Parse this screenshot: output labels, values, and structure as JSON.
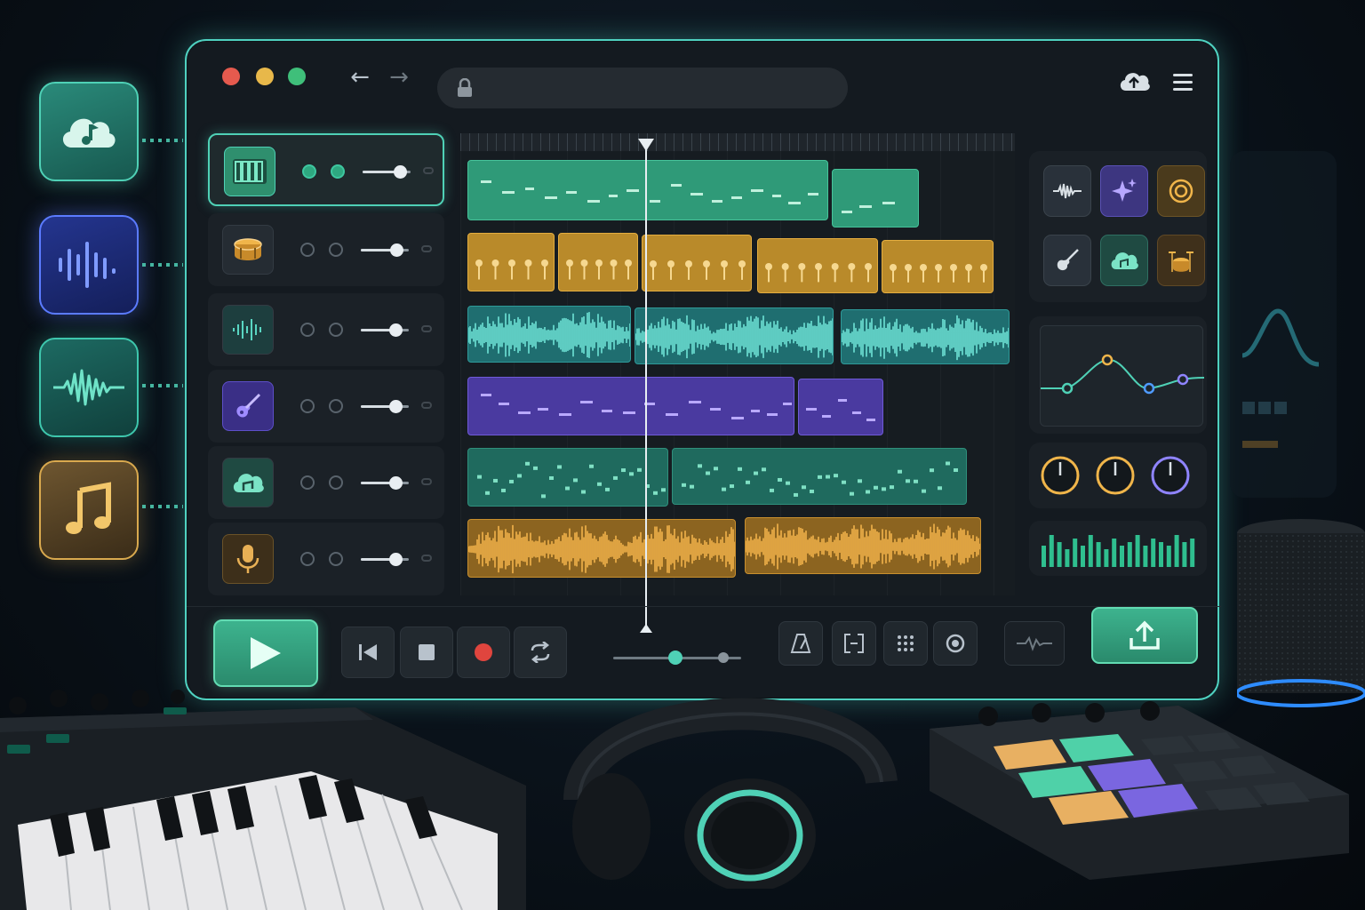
{
  "colors": {
    "accent": "#4fd1b6",
    "green": "#2f9a78",
    "yellow": "#b98a2a",
    "teal": "#1f6e70",
    "purple": "#4a3aa0",
    "amber": "#8c6420"
  },
  "window": {
    "traffic_lights": [
      "close",
      "minimize",
      "maximize"
    ],
    "nav_back_icon": "←",
    "nav_forward_icon": "→",
    "url": ""
  },
  "sources": [
    {
      "icon": "cloud-music-icon"
    },
    {
      "icon": "audio-bars-icon"
    },
    {
      "icon": "waveform-icon"
    },
    {
      "icon": "music-note-icon"
    }
  ],
  "tracks": [
    {
      "icon": "piano-keys-icon",
      "volume": 0.78,
      "armed": true,
      "selected": true
    },
    {
      "icon": "drum-icon",
      "volume": 0.74,
      "armed": false
    },
    {
      "icon": "waveform-icon",
      "volume": 0.72,
      "armed": false
    },
    {
      "icon": "guitar-icon",
      "volume": 0.72,
      "armed": false
    },
    {
      "icon": "cloud-music-icon",
      "volume": 0.72,
      "armed": false
    },
    {
      "icon": "microphone-icon",
      "volume": 0.72,
      "armed": false
    }
  ],
  "playhead_position": 0.33,
  "instruments": [
    "waveform-icon",
    "sparkle-icon",
    "target-icon",
    "guitar-icon",
    "cloud-music-icon",
    "drum-kit-icon"
  ],
  "eq_points": 4,
  "knobs": [
    0.6,
    0.5,
    0.7
  ],
  "meter_levels": [
    0.6,
    0.9,
    0.7,
    0.5,
    0.8,
    0.6,
    0.9,
    0.7,
    0.5,
    0.8,
    0.6,
    0.7,
    0.9,
    0.6,
    0.8,
    0.7,
    0.6,
    0.9,
    0.7,
    0.8
  ],
  "transport": {
    "tempo_slider": 0.5
  }
}
